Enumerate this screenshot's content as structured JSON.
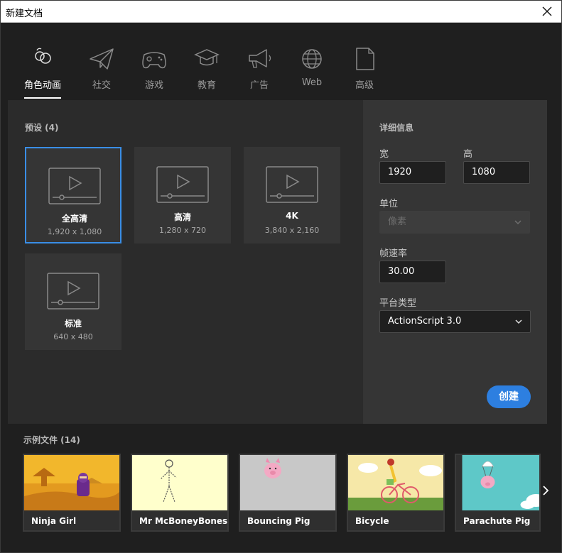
{
  "window": {
    "title": "新建文档"
  },
  "tabs": [
    {
      "label": "角色动画",
      "icon": "character-animation-icon"
    },
    {
      "label": "社交",
      "icon": "paper-plane-icon"
    },
    {
      "label": "游戏",
      "icon": "gamepad-icon"
    },
    {
      "label": "教育",
      "icon": "graduation-cap-icon"
    },
    {
      "label": "广告",
      "icon": "megaphone-icon"
    },
    {
      "label": "Web",
      "icon": "globe-icon"
    },
    {
      "label": "高级",
      "icon": "document-icon"
    }
  ],
  "presets": {
    "title": "预设 (4)",
    "items": [
      {
        "name": "全高清",
        "dims": "1,920 x 1,080"
      },
      {
        "name": "高清",
        "dims": "1,280 x 720"
      },
      {
        "name": "4K",
        "dims": "3,840 x 2,160"
      },
      {
        "name": "标准",
        "dims": "640 x 480"
      }
    ]
  },
  "details": {
    "title": "详细信息",
    "width_label": "宽",
    "width_value": "1920",
    "height_label": "高",
    "height_value": "1080",
    "units_label": "单位",
    "units_value": "像素",
    "fps_label": "帧速率",
    "fps_value": "30.00",
    "platform_label": "平台类型",
    "platform_value": "ActionScript 3.0",
    "create_label": "创建"
  },
  "samples": {
    "title": "示例文件 (14)",
    "items": [
      {
        "name": "Ninja Girl"
      },
      {
        "name": "Mr McBoneyBones"
      },
      {
        "name": "Bouncing Pig"
      },
      {
        "name": "Bicycle"
      },
      {
        "name": "Parachute Pig"
      }
    ]
  },
  "colors": {
    "accent": "#2d7fe0",
    "selected_border": "#3a8ee6"
  }
}
